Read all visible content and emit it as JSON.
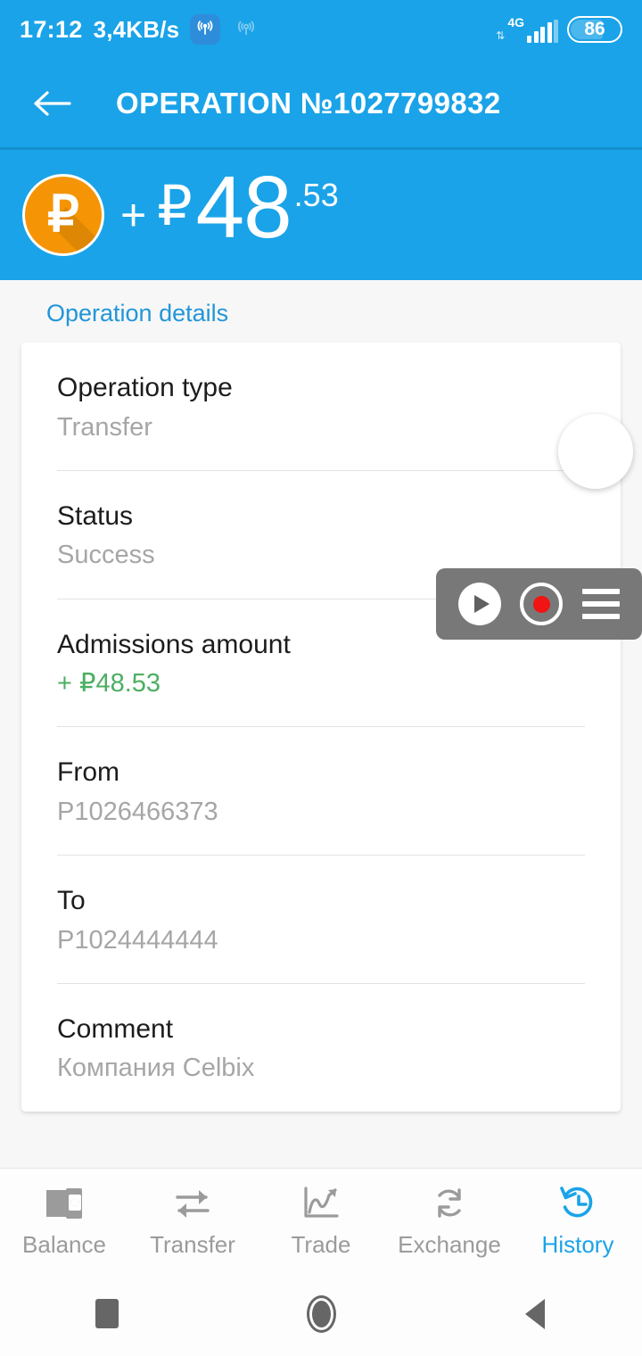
{
  "status_bar": {
    "time": "17:12",
    "data_rate": "3,4KB/s",
    "hotspot_on_icon": "hotspot-active-icon",
    "hotspot_off_icon": "hotspot-inactive-icon",
    "network_type": "4G",
    "signal_icon": "signal-bars-icon",
    "battery_level": "86"
  },
  "toolbar": {
    "back_icon": "back-arrow-icon",
    "title": "OPERATION №1027799832"
  },
  "amount_banner": {
    "coin_icon": "ruble-coin-icon",
    "coin_glyph": "₽",
    "sign": "+",
    "currency": "₽",
    "integer": "48",
    "fraction": ".53"
  },
  "section": {
    "title": "Operation details"
  },
  "details": [
    {
      "label": "Operation type",
      "value": "Transfer",
      "positive": false
    },
    {
      "label": "Status",
      "value": "Success",
      "positive": false
    },
    {
      "label": "Admissions amount",
      "value": "+ ₽48.53",
      "positive": true
    },
    {
      "label": "From",
      "value": "P1026466373",
      "positive": false
    },
    {
      "label": "To",
      "value": "P1024444444",
      "positive": false
    },
    {
      "label": "Comment",
      "value": "Компания Celbix",
      "positive": false
    }
  ],
  "recorder_overlay": {
    "bubble_icon": "floating-bubble-icon",
    "play_icon": "play-icon",
    "record_icon": "record-icon",
    "menu_icon": "hamburger-menu-icon"
  },
  "tabs": [
    {
      "label": "Balance",
      "icon": "wallet-icon",
      "active": false
    },
    {
      "label": "Transfer",
      "icon": "transfer-arrows-icon",
      "active": false
    },
    {
      "label": "Trade",
      "icon": "chart-up-icon",
      "active": false
    },
    {
      "label": "Exchange",
      "icon": "refresh-icon",
      "active": false
    },
    {
      "label": "History",
      "icon": "history-clock-icon",
      "active": true
    }
  ],
  "android_nav": {
    "recents_icon": "recents-square-icon",
    "home_icon": "home-circle-icon",
    "back_icon": "back-triangle-icon"
  },
  "colors": {
    "brand_blue": "#1aa3e8",
    "accent_link": "#2196d9",
    "positive_green": "#4caf62",
    "coin_orange": "#f59505",
    "muted_text": "#a6a6a6",
    "record_red": "#f01414"
  }
}
